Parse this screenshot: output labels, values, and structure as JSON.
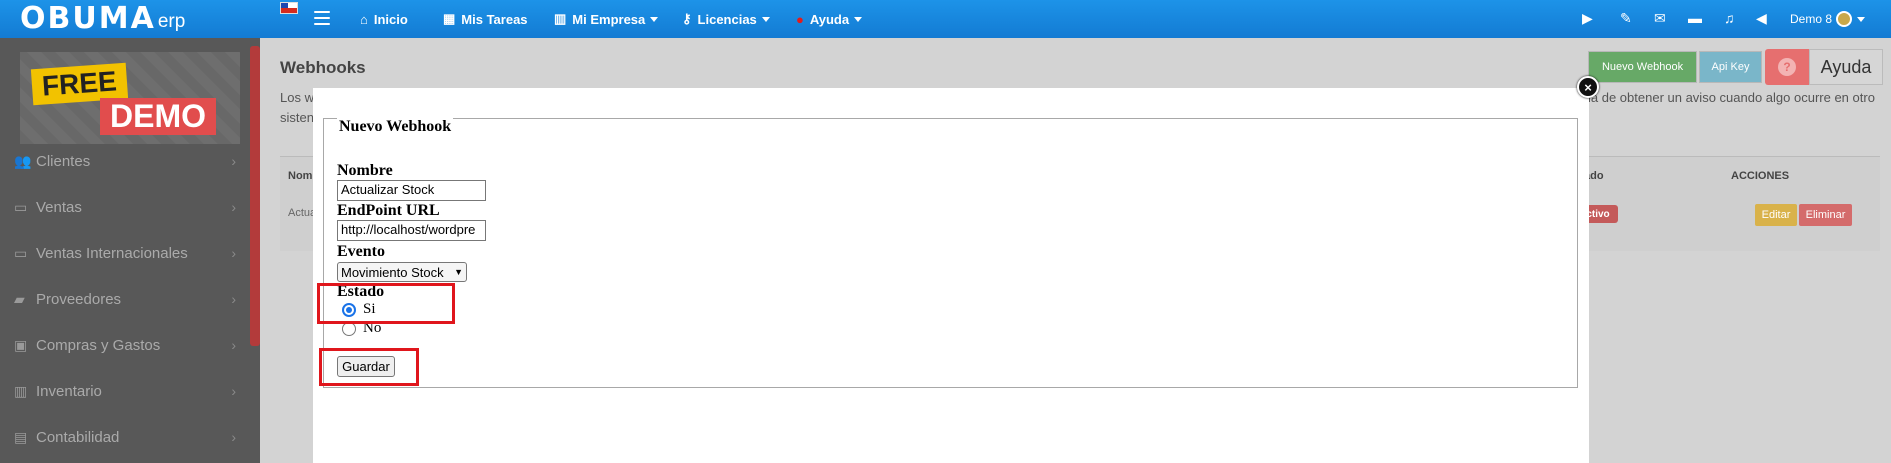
{
  "navbar": {
    "logo": "OBUMA",
    "logo_suffix": "erp",
    "items": [
      {
        "label": "Inicio",
        "icon": "home-icon"
      },
      {
        "label": "Mis Tareas",
        "icon": "calendar-icon"
      },
      {
        "label": "Mi Empresa",
        "icon": "building-icon"
      },
      {
        "label": "Licencias",
        "icon": "key-icon"
      },
      {
        "label": "Ayuda",
        "icon": "help-icon"
      }
    ],
    "user": "Demo 8"
  },
  "sidebar": {
    "banner_free": "FREE",
    "banner_demo": "DEMO",
    "items": [
      {
        "label": "Clientes",
        "icon": "users-icon"
      },
      {
        "label": "Ventas",
        "icon": "money-icon"
      },
      {
        "label": "Ventas Internacionales",
        "icon": "money-icon"
      },
      {
        "label": "Proveedores",
        "icon": "truck-icon"
      },
      {
        "label": "Compras y Gastos",
        "icon": "money-icon"
      },
      {
        "label": "Inventario",
        "icon": "barcode-icon"
      },
      {
        "label": "Contabilidad",
        "icon": "book-icon"
      }
    ]
  },
  "page": {
    "title": "Webhooks",
    "desc_start": "Los w",
    "desc_line2_start": "sisten",
    "desc_right": "ia de obtener un aviso cuando algo ocurre en otro",
    "buttons": {
      "new_webhook": "Nuevo Webhook",
      "api_key": "Api Key",
      "help_q": "?",
      "help": "Ayuda"
    },
    "table": {
      "col_name": "Nom",
      "col_state": "ado",
      "col_actions": "ACCIONES",
      "row_name": "Actua",
      "row_state": "ctivo",
      "edit": "Editar",
      "delete": "Eliminar"
    }
  },
  "modal": {
    "close": "×",
    "legend": "Nuevo Webhook",
    "name_label": "Nombre",
    "name_value": "Actualizar Stock",
    "url_label": "EndPoint URL",
    "url_value": "http://localhost/wordpre",
    "event_label": "Evento",
    "event_value": "Movimiento Stock",
    "state_label": "Estado",
    "state_yes": "Si",
    "state_no": "No",
    "save": "Guardar"
  },
  "colors": {
    "navbar": "#1a88e0",
    "highlight": "#e0161c",
    "new_webhook": "#5cb85c",
    "api_key": "#5bc0de"
  }
}
